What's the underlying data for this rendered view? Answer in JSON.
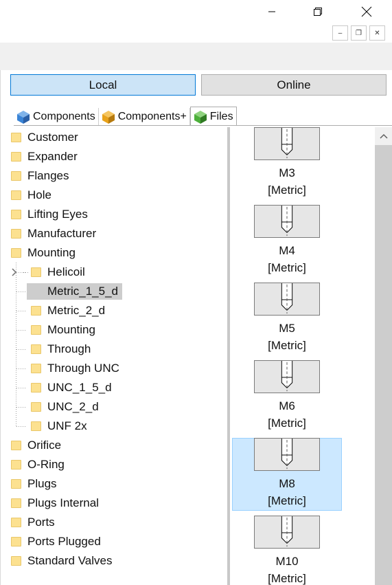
{
  "window": {
    "minimize_icon": "minimize-icon",
    "restore_icon": "restore-icon",
    "close_icon": "close-icon",
    "mdi_minimize": "–",
    "mdi_restore": "❐",
    "mdi_close": "✕"
  },
  "toggle": {
    "local": "Local",
    "online": "Online",
    "active": "Local"
  },
  "tabs": [
    {
      "label": "Components",
      "icon": "components-cube-icon",
      "color": "#3a84d6"
    },
    {
      "label": "Components+",
      "icon": "components-plus-cube-icon",
      "color": "#e8a21a"
    },
    {
      "label": "Files",
      "icon": "files-cube-icon",
      "color": "#4caf3a"
    }
  ],
  "active_tab": "Files",
  "tree": {
    "top_items": [
      "Customer",
      "Expander",
      "Flanges",
      "Hole",
      "Lifting Eyes",
      "Manufacturer",
      "Mounting"
    ],
    "mounting_children": [
      "Helicoil",
      "Metric_1_5_d",
      "Metric_2_d",
      "Mounting",
      "Through",
      "Through UNC",
      "UNC_1_5_d",
      "UNC_2_d",
      "UNF 2x"
    ],
    "selected": "Metric_1_5_d",
    "bottom_items": [
      "Orifice",
      "O-Ring",
      "Plugs",
      "Plugs Internal",
      "Ports",
      "Ports Plugged",
      "Standard Valves"
    ]
  },
  "thumbnails": [
    {
      "name": "M3",
      "unit": "[Metric]"
    },
    {
      "name": "M4",
      "unit": "[Metric]"
    },
    {
      "name": "M5",
      "unit": "[Metric]"
    },
    {
      "name": "M6",
      "unit": "[Metric]"
    },
    {
      "name": "M8",
      "unit": "[Metric]"
    },
    {
      "name": "M10",
      "unit": "[Metric]"
    }
  ],
  "selected_thumbnail": "M8",
  "colors": {
    "accent": "#0078d7",
    "selection": "#cce8ff",
    "folder": "#fce190"
  }
}
